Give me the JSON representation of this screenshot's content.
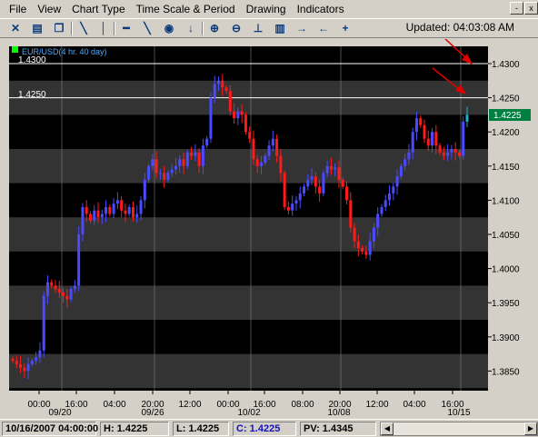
{
  "menu": [
    "File",
    "View",
    "Chart Type",
    "Time Scale & Period",
    "Drawing",
    "Indicators"
  ],
  "window_controls": [
    "-",
    "x"
  ],
  "toolbar_icons": [
    "crosshair-icon",
    "print-icon",
    "copy-icon",
    "line-tool-icon",
    "vertical-line-icon",
    "horizontal-line-icon",
    "target-icon",
    "arrow-down-icon",
    "zoom-in-icon",
    "zoom-out-icon",
    "baseline-icon",
    "chart-indicator-icon",
    "arrow-right-icon",
    "arrow-left-icon",
    "plus-icon"
  ],
  "updated": "Updated: 04:03:08 AM",
  "chart": {
    "instrument_label": "EUR/USD(4 hr.  40 day)",
    "current_price_label": "1.4225",
    "hline_labels": [
      "1.4300",
      "1.4250"
    ]
  },
  "chart_data": {
    "type": "candlestick",
    "y_ticks": [
      "1.4300",
      "1.4250",
      "1.4200",
      "1.4150",
      "1.4100",
      "1.4050",
      "1.4000",
      "1.3950",
      "1.3900",
      "1.3850"
    ],
    "x_ticks": [
      "00:00",
      "16:00",
      "04:00",
      "20:00",
      "12:00",
      "00:00",
      "16:00",
      "08:00",
      "20:00",
      "12:00",
      "04:00",
      "16:00"
    ],
    "x_dates": [
      "09/20",
      "09/26",
      "10/02",
      "10/08",
      "10/15"
    ],
    "ylim": [
      1.3825,
      1.433
    ],
    "horizontal_lines": [
      1.43,
      1.425
    ],
    "current_price": 1.4225,
    "closes": [
      1.3865,
      1.386,
      1.3855,
      1.385,
      1.386,
      1.3865,
      1.387,
      1.388,
      1.396,
      1.398,
      1.3975,
      1.397,
      1.3965,
      1.396,
      1.3955,
      1.397,
      1.3975,
      1.405,
      1.409,
      1.408,
      1.407,
      1.4085,
      1.4075,
      1.408,
      1.409,
      1.408,
      1.4095,
      1.41,
      1.4085,
      1.408,
      1.409,
      1.4075,
      1.408,
      1.41,
      1.413,
      1.415,
      1.416,
      1.414,
      1.414,
      1.413,
      1.414,
      1.4145,
      1.415,
      1.416,
      1.415,
      1.417,
      1.4165,
      1.417,
      1.415,
      1.418,
      1.419,
      1.425,
      1.427,
      1.4275,
      1.4265,
      1.426,
      1.423,
      1.422,
      1.423,
      1.4225,
      1.42,
      1.419,
      1.416,
      1.415,
      1.4155,
      1.4165,
      1.418,
      1.419,
      1.4165,
      1.414,
      1.409,
      1.4085,
      1.4095,
      1.41,
      1.411,
      1.412,
      1.413,
      1.4135,
      1.412,
      1.411,
      1.414,
      1.415,
      1.4145,
      1.4148,
      1.413,
      1.412,
      1.41,
      1.406,
      1.404,
      1.403,
      1.4025,
      1.402,
      1.404,
      1.406,
      1.408,
      1.409,
      1.41,
      1.411,
      1.412,
      1.4135,
      1.415,
      1.416,
      1.417,
      1.42,
      1.422,
      1.421,
      1.419,
      1.418,
      1.42,
      1.418,
      1.417,
      1.4165,
      1.417,
      1.4175,
      1.417,
      1.4165,
      1.4215,
      1.4225
    ]
  },
  "status": {
    "datetime": "10/16/2007 04:00:00",
    "high": "H: 1.4225",
    "low": "L: 1.4225",
    "close": "C: 1.4225",
    "pv": "PV: 1.4345"
  },
  "colors": {
    "bull": "#4a4aff",
    "bear": "#ff1a1a",
    "band_dark": "#000000",
    "band_light": "#333333",
    "price_badge": "#008040",
    "cursor_arrow": "#e00000"
  }
}
